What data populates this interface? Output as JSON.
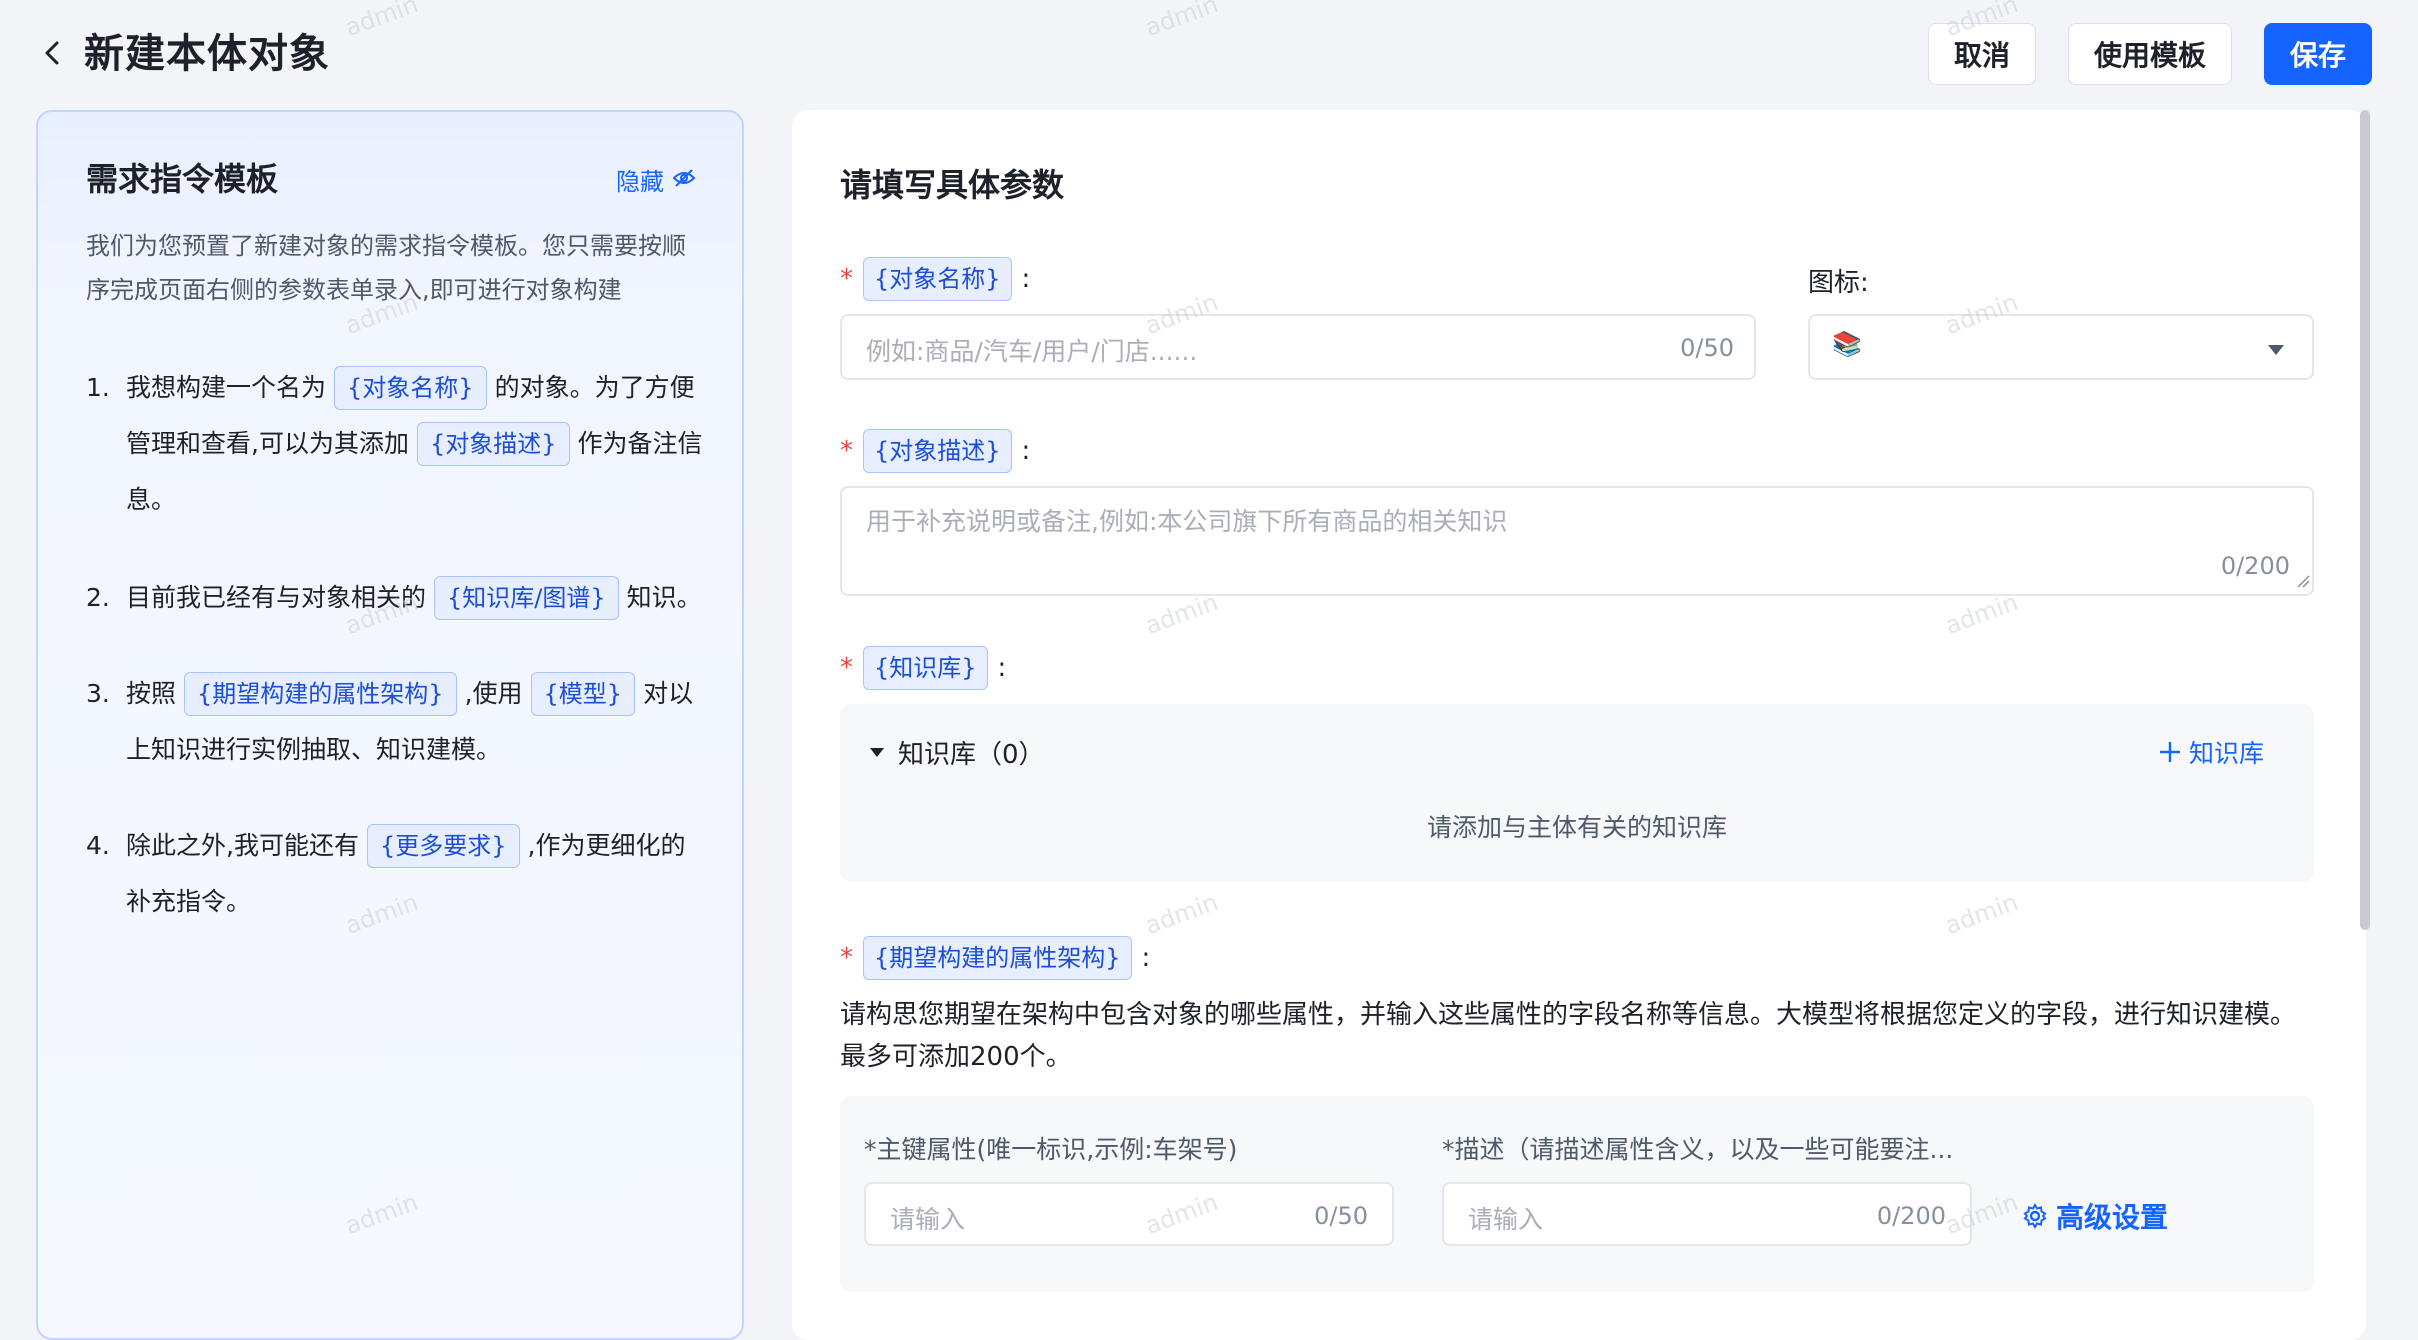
{
  "header": {
    "title": "新建本体对象",
    "cancel": "取消",
    "use_template": "使用模板",
    "save": "保存"
  },
  "left_panel": {
    "title": "需求指令模板",
    "hide_label": "隐藏",
    "description": "我们为您预置了新建对象的需求指令模板。您只需要按顺序完成页面右侧的参数表单录入,即可进行对象构建",
    "steps": [
      {
        "num": "1.",
        "t1": "我想构建一个名为",
        "tag1": "{对象名称}",
        "t2": "的对象。为了方便管理和查看,可以为其添加",
        "tag2": "{对象描述}",
        "t3": "作为备注信息。"
      },
      {
        "num": "2.",
        "t1": "目前我已经有与对象相关的",
        "tag1": "{知识库/图谱}",
        "t2": "知识。"
      },
      {
        "num": "3.",
        "t1": "按照",
        "tag1": "{期望构建的属性架构}",
        "t2": ",使用",
        "tag2": "{模型}",
        "t3": "对以上知识进行实例抽取、知识建模。"
      },
      {
        "num": "4.",
        "t1": "除此之外,我可能还有",
        "tag1": "{更多要求}",
        "t2": ",作为更细化的补充指令。"
      }
    ]
  },
  "form": {
    "section_title": "请填写具体参数",
    "required_mark": "*",
    "colon": ":",
    "name_tag": "{对象名称}",
    "name_placeholder": "例如:商品/汽车/用户/门店......",
    "name_counter": "0/50",
    "icon_label": "图标:",
    "icon_value": "📚",
    "desc_tag": "{对象描述}",
    "desc_placeholder": "用于补充说明或备注,例如:本公司旗下所有商品的相关知识",
    "desc_counter": "0/200",
    "kb_tag": "{知识库}",
    "kb_header": "知识库（0）",
    "kb_add": "知识库",
    "kb_empty": "请添加与主体有关的知识库",
    "attr_tag": "{期望构建的属性架构}",
    "attr_desc": "请构思您期望在架构中包含对象的哪些属性，并输入这些属性的字段名称等信息。大模型将根据您定义的字段，进行知识建模。最多可添加200个。",
    "pk_label": "*主键属性(唯一标识,示例:车架号)",
    "pk_placeholder": "请输入",
    "pk_counter": "0/50",
    "attr_desc_label": "*描述（请描述属性含义，以及一些可能要注...",
    "attr_desc_placeholder": "请输入",
    "attr_desc_counter": "0/200",
    "advanced": "高级设置"
  },
  "watermark": "admin"
}
